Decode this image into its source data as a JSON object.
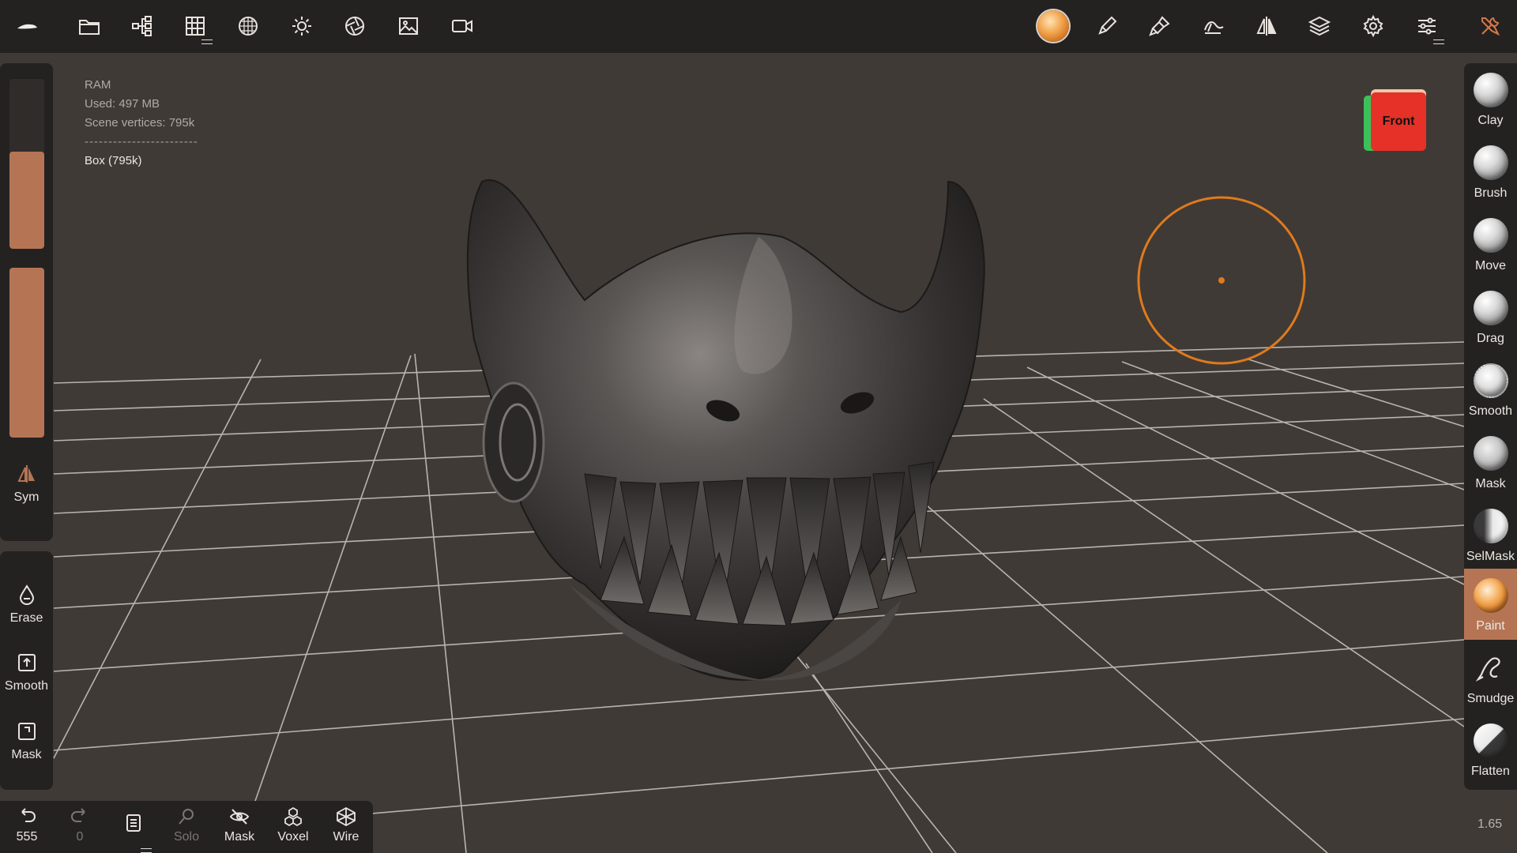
{
  "info": {
    "ram_label": "RAM",
    "used": "Used: 497 MB",
    "vertices": "Scene vertices: 795k",
    "separator": "------------------------",
    "object": "Box (795k)"
  },
  "viewcube": {
    "label": "Front"
  },
  "left_panel": {
    "radius_fill": 0.57,
    "intensity_fill": 1.0,
    "sym_label": "Sym",
    "erase_label": "Erase",
    "smooth_label": "Smooth",
    "mask_label": "Mask"
  },
  "tools": [
    {
      "label": "Clay",
      "icon": "clay-sphere-icon"
    },
    {
      "label": "Brush",
      "icon": "brush-sphere-icon"
    },
    {
      "label": "Move",
      "icon": "move-sphere-icon"
    },
    {
      "label": "Drag",
      "icon": "drag-sphere-icon"
    },
    {
      "label": "Smooth",
      "icon": "smooth-sphere-icon"
    },
    {
      "label": "Mask",
      "icon": "mask-sphere-icon"
    },
    {
      "label": "SelMask",
      "icon": "selmask-sphere-icon"
    },
    {
      "label": "Paint",
      "icon": "paint-sphere-icon",
      "active": true
    },
    {
      "label": "Smudge",
      "icon": "smudge-icon"
    },
    {
      "label": "Flatten",
      "icon": "flatten-sphere-icon"
    }
  ],
  "bottom": {
    "undo_count": "555",
    "redo_count": "0",
    "solo_label": "Solo",
    "mask_label": "Mask",
    "voxel_label": "Voxel",
    "wire_label": "Wire"
  },
  "zoom": "1.65",
  "colors": {
    "accent": "#b57555",
    "panel": "#242221",
    "background": "#3f3a36",
    "brush_cursor": "#e07a1c",
    "viewcube_front": "#e53127"
  }
}
